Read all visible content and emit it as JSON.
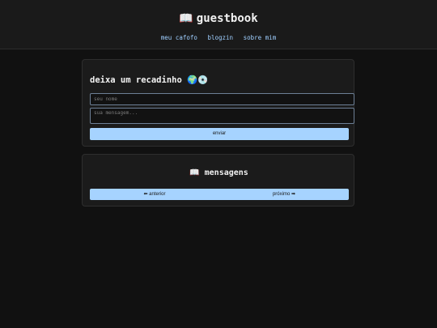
{
  "header": {
    "icon": "📖",
    "title": "guestbook",
    "nav": [
      "meu cafofo",
      "blogzin",
      "sobre mim"
    ]
  },
  "form": {
    "title": "deixa um recadinho 🌍💿",
    "name_placeholder": "seu nome",
    "message_placeholder": "sua mensagem...",
    "send_label": "enviar"
  },
  "messages": {
    "title": "📖 mensagens",
    "prev_label": "⬅ anterior",
    "next_label": "próximo ➡"
  },
  "colors": {
    "background": "#111111",
    "card": "#1b1b1b",
    "accent": "#a6d3ff",
    "link": "#9fcfff"
  }
}
